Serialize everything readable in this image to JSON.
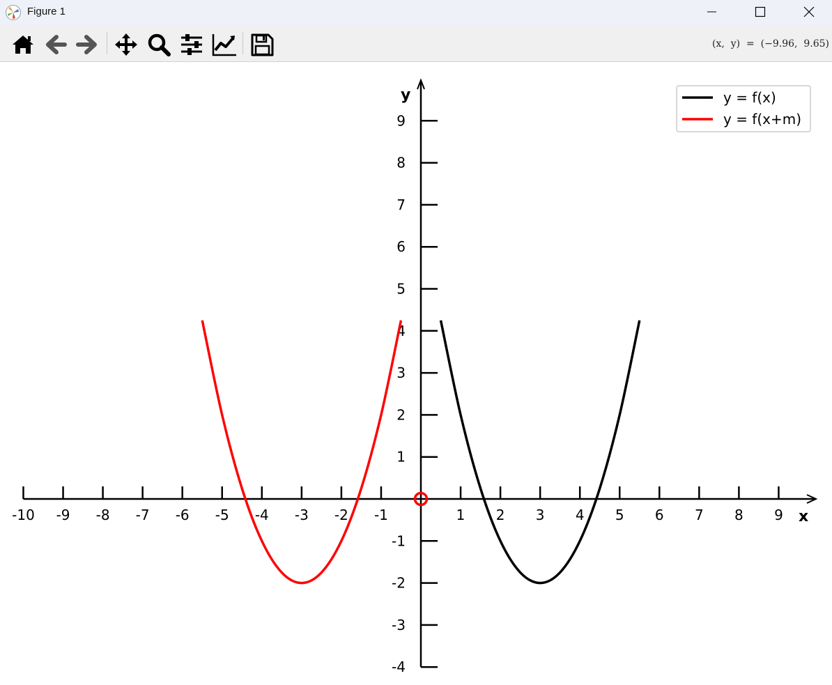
{
  "window": {
    "title": "Figure 1",
    "app_icon": "matplotlib-icon",
    "controls": [
      "minimize-icon",
      "maximize-icon",
      "close-icon"
    ]
  },
  "toolbar": {
    "buttons": [
      "home-icon",
      "back-arrow-icon",
      "forward-arrow-icon",
      "pan-icon",
      "zoom-icon",
      "configure-subplots-icon",
      "edit-axis-icon",
      "save-icon"
    ],
    "coords": "(x,  y)  =  (−9.96,  9.65)"
  },
  "chart_data": {
    "type": "line",
    "xlabel": "x",
    "ylabel": "y",
    "xlim": [
      -10,
      10
    ],
    "ylim": [
      -4,
      10
    ],
    "xticks": [
      "-10",
      "-9",
      "-8",
      "-7",
      "-6",
      "-5",
      "-4",
      "-3",
      "-2",
      "-1",
      "1",
      "2",
      "3",
      "4",
      "5",
      "6",
      "7",
      "8",
      "9"
    ],
    "yticks": [
      "-4",
      "-3",
      "-2",
      "-1",
      "1",
      "2",
      "3",
      "4",
      "5",
      "6",
      "7",
      "8",
      "9"
    ],
    "legend_position": "top-right",
    "grid": false,
    "origin_marker": {
      "x": 0,
      "y": 0,
      "color": "#ff0000"
    },
    "series": [
      {
        "name": "y = f(x)",
        "color": "#000000",
        "x": [
          0.5,
          1.0,
          1.5,
          2.0,
          2.5,
          3.0,
          3.5,
          4.0,
          4.5,
          5.0,
          5.5
        ],
        "y": [
          4.25,
          2.0,
          0.25,
          -1.0,
          -1.75,
          -2.0,
          -1.75,
          -1.0,
          0.25,
          2.0,
          4.25
        ]
      },
      {
        "name": "y = f(x+m)",
        "color": "#ff0000",
        "x": [
          -5.5,
          -5.0,
          -4.5,
          -4.0,
          -3.5,
          -3.0,
          -2.5,
          -2.0,
          -1.5,
          -1.0,
          -0.5
        ],
        "y": [
          4.25,
          2.0,
          0.25,
          -1.0,
          -1.75,
          -2.0,
          -1.75,
          -1.0,
          0.25,
          2.0,
          4.25
        ]
      }
    ]
  }
}
